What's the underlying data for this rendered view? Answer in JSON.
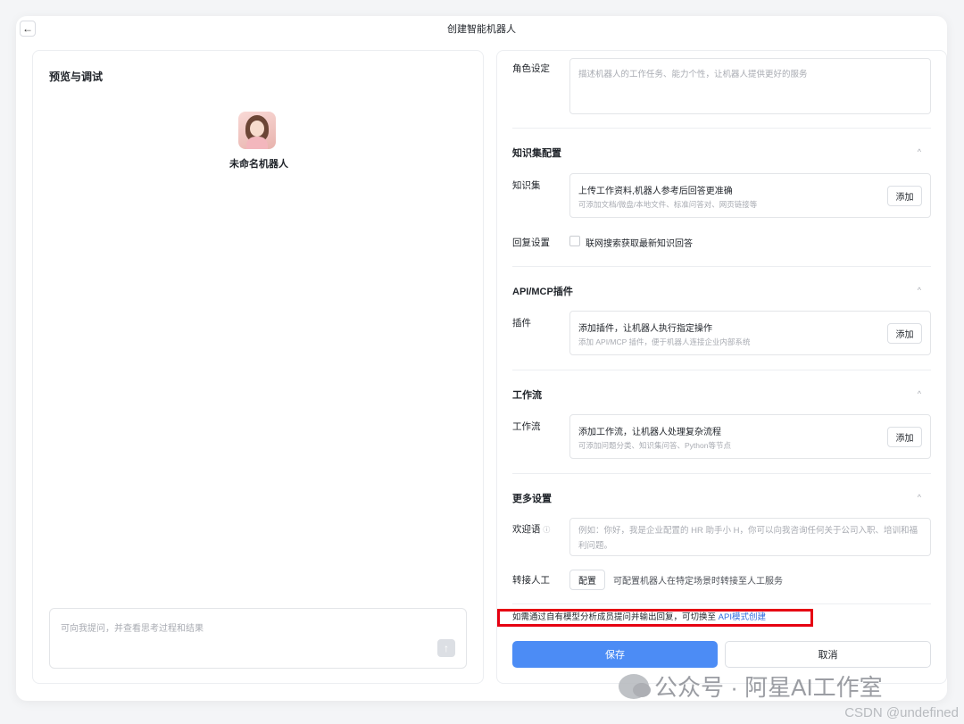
{
  "window": {
    "title": "创建智能机器人",
    "back_icon": "←"
  },
  "preview": {
    "title": "预览与调试",
    "bot_name": "未命名机器人",
    "chat_placeholder": "可向我提问，并查看思考过程和结果",
    "send_icon": "↑"
  },
  "config": {
    "role": {
      "label": "角色设定",
      "placeholder": "描述机器人的工作任务、能力个性，让机器人提供更好的服务"
    },
    "knowledge": {
      "section_title": "知识集配置",
      "label": "知识集",
      "card_title": "上传工作资料,机器人参考后回答更准确",
      "card_sub": "可添加文档/微盘/本地文件、标准问答对、网页链接等",
      "add_label": "添加",
      "reply_label": "回复设置",
      "reply_option": "联网搜索获取最新知识回答"
    },
    "plugin": {
      "section_title": "API/MCP插件",
      "label": "插件",
      "card_title": "添加插件，让机器人执行指定操作",
      "card_sub": "添加 API/MCP 插件，便于机器人连接企业内部系统",
      "add_label": "添加"
    },
    "workflow": {
      "section_title": "工作流",
      "label": "工作流",
      "card_title": "添加工作流，让机器人处理复杂流程",
      "card_sub": "可添加问题分类、知识集问答、Python等节点",
      "add_label": "添加"
    },
    "more": {
      "section_title": "更多设置",
      "welcome_label": "欢迎语",
      "info_icon": "ⓘ",
      "welcome_placeholder": "例如：你好，我是企业配置的 HR 助手小 H，你可以向我咨询任何关于公司入职、培训和福利问题。",
      "transfer_label": "转接人工",
      "config_label": "配置",
      "transfer_desc": "可配置机器人在特定场景时转接至人工服务"
    },
    "caret": "^",
    "notice_text": "如需通过自有模型分析成员提问并输出回复，可切换至",
    "notice_link": "API模式创建",
    "save_label": "保存",
    "cancel_label": "取消"
  },
  "watermark": {
    "text": "公众号 · 阿星AI工作室",
    "csdn": "CSDN @undefined"
  },
  "colors": {
    "accent": "#4c8cf5",
    "highlight_border": "#e60012",
    "link": "#2f6bde"
  }
}
